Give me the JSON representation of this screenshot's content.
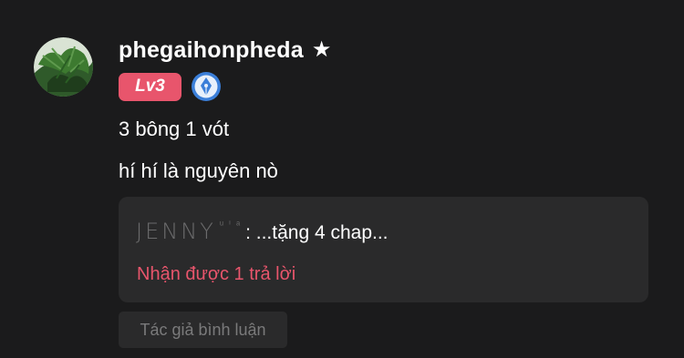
{
  "comment": {
    "username": "phegaihonpheda",
    "star_glyph": "★",
    "level_badge": "Lv3",
    "author_badge_icon": "pen-nib-badge-icon",
    "lines": [
      "3 bông 1 vót",
      "hí hí là nguyên nò"
    ],
    "reply_preview": {
      "name": "JENNY",
      "name_suffix": "ᵘⁱᵃ",
      "separator": ":",
      "text": " ...tặng 4 chap..."
    },
    "replies_link": "Nhận được 1 trả lời",
    "author_label": "Tác giả bình luận"
  },
  "colors": {
    "background": "#1b1b1c",
    "accent": "#e8556c",
    "reply_box": "#2a2a2b",
    "muted": "#7a7a7b"
  }
}
